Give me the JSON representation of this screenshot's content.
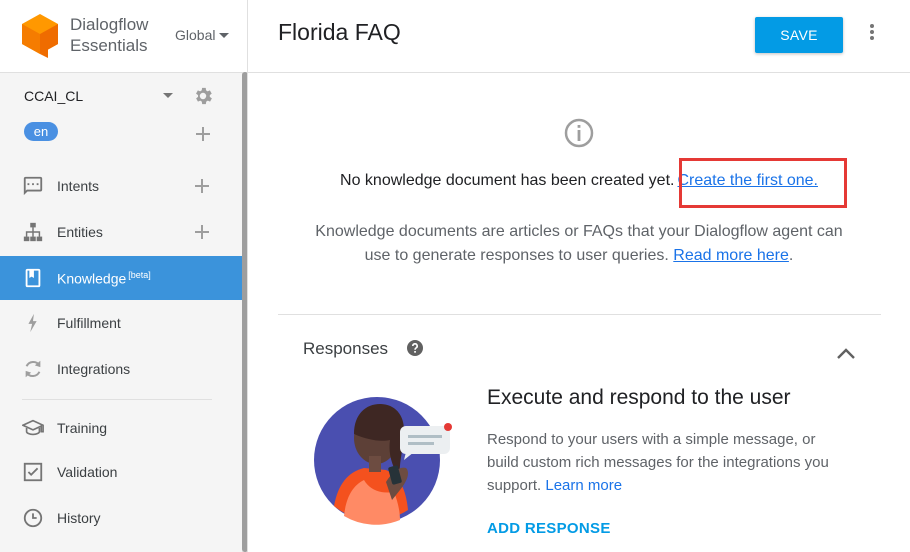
{
  "brand": {
    "line1": "Dialogflow",
    "line2": "Essentials",
    "region": "Global"
  },
  "agent": {
    "name": "CCAI_CL",
    "language": "en"
  },
  "sidebar": {
    "items": [
      {
        "label": "Intents",
        "icon": "chat-icon"
      },
      {
        "label": "Entities",
        "icon": "hierarchy-icon"
      },
      {
        "label": "Knowledge",
        "badge": "[beta]",
        "icon": "book-icon",
        "active": true
      },
      {
        "label": "Fulfillment",
        "icon": "bolt-icon"
      },
      {
        "label": "Integrations",
        "icon": "sync-icon"
      },
      {
        "label": "Training",
        "icon": "graduation-cap-icon"
      },
      {
        "label": "Validation",
        "icon": "checkbox-icon"
      },
      {
        "label": "History",
        "icon": "clock-icon"
      }
    ]
  },
  "header": {
    "title": "Florida FAQ",
    "save_label": "SAVE"
  },
  "knowledge": {
    "empty_text": "No knowledge document has been created yet.",
    "create_link": "Create the first one.",
    "desc_text": "Knowledge documents are articles or FAQs that your Dialogflow agent can use to generate responses to user queries.",
    "read_more": "Read more here",
    "read_more_suffix": "."
  },
  "responses": {
    "title": "Responses",
    "heading": "Execute and respond to the user",
    "text": "Respond to your users with a simple message, or build custom rich messages for the integrations you support.",
    "learn_more": "Learn more",
    "add_label": "ADD RESPONSE"
  },
  "colors": {
    "accent": "#039be5",
    "active_nav": "#3b93db",
    "logo": "#f57c00",
    "highlight": "#e53935"
  }
}
